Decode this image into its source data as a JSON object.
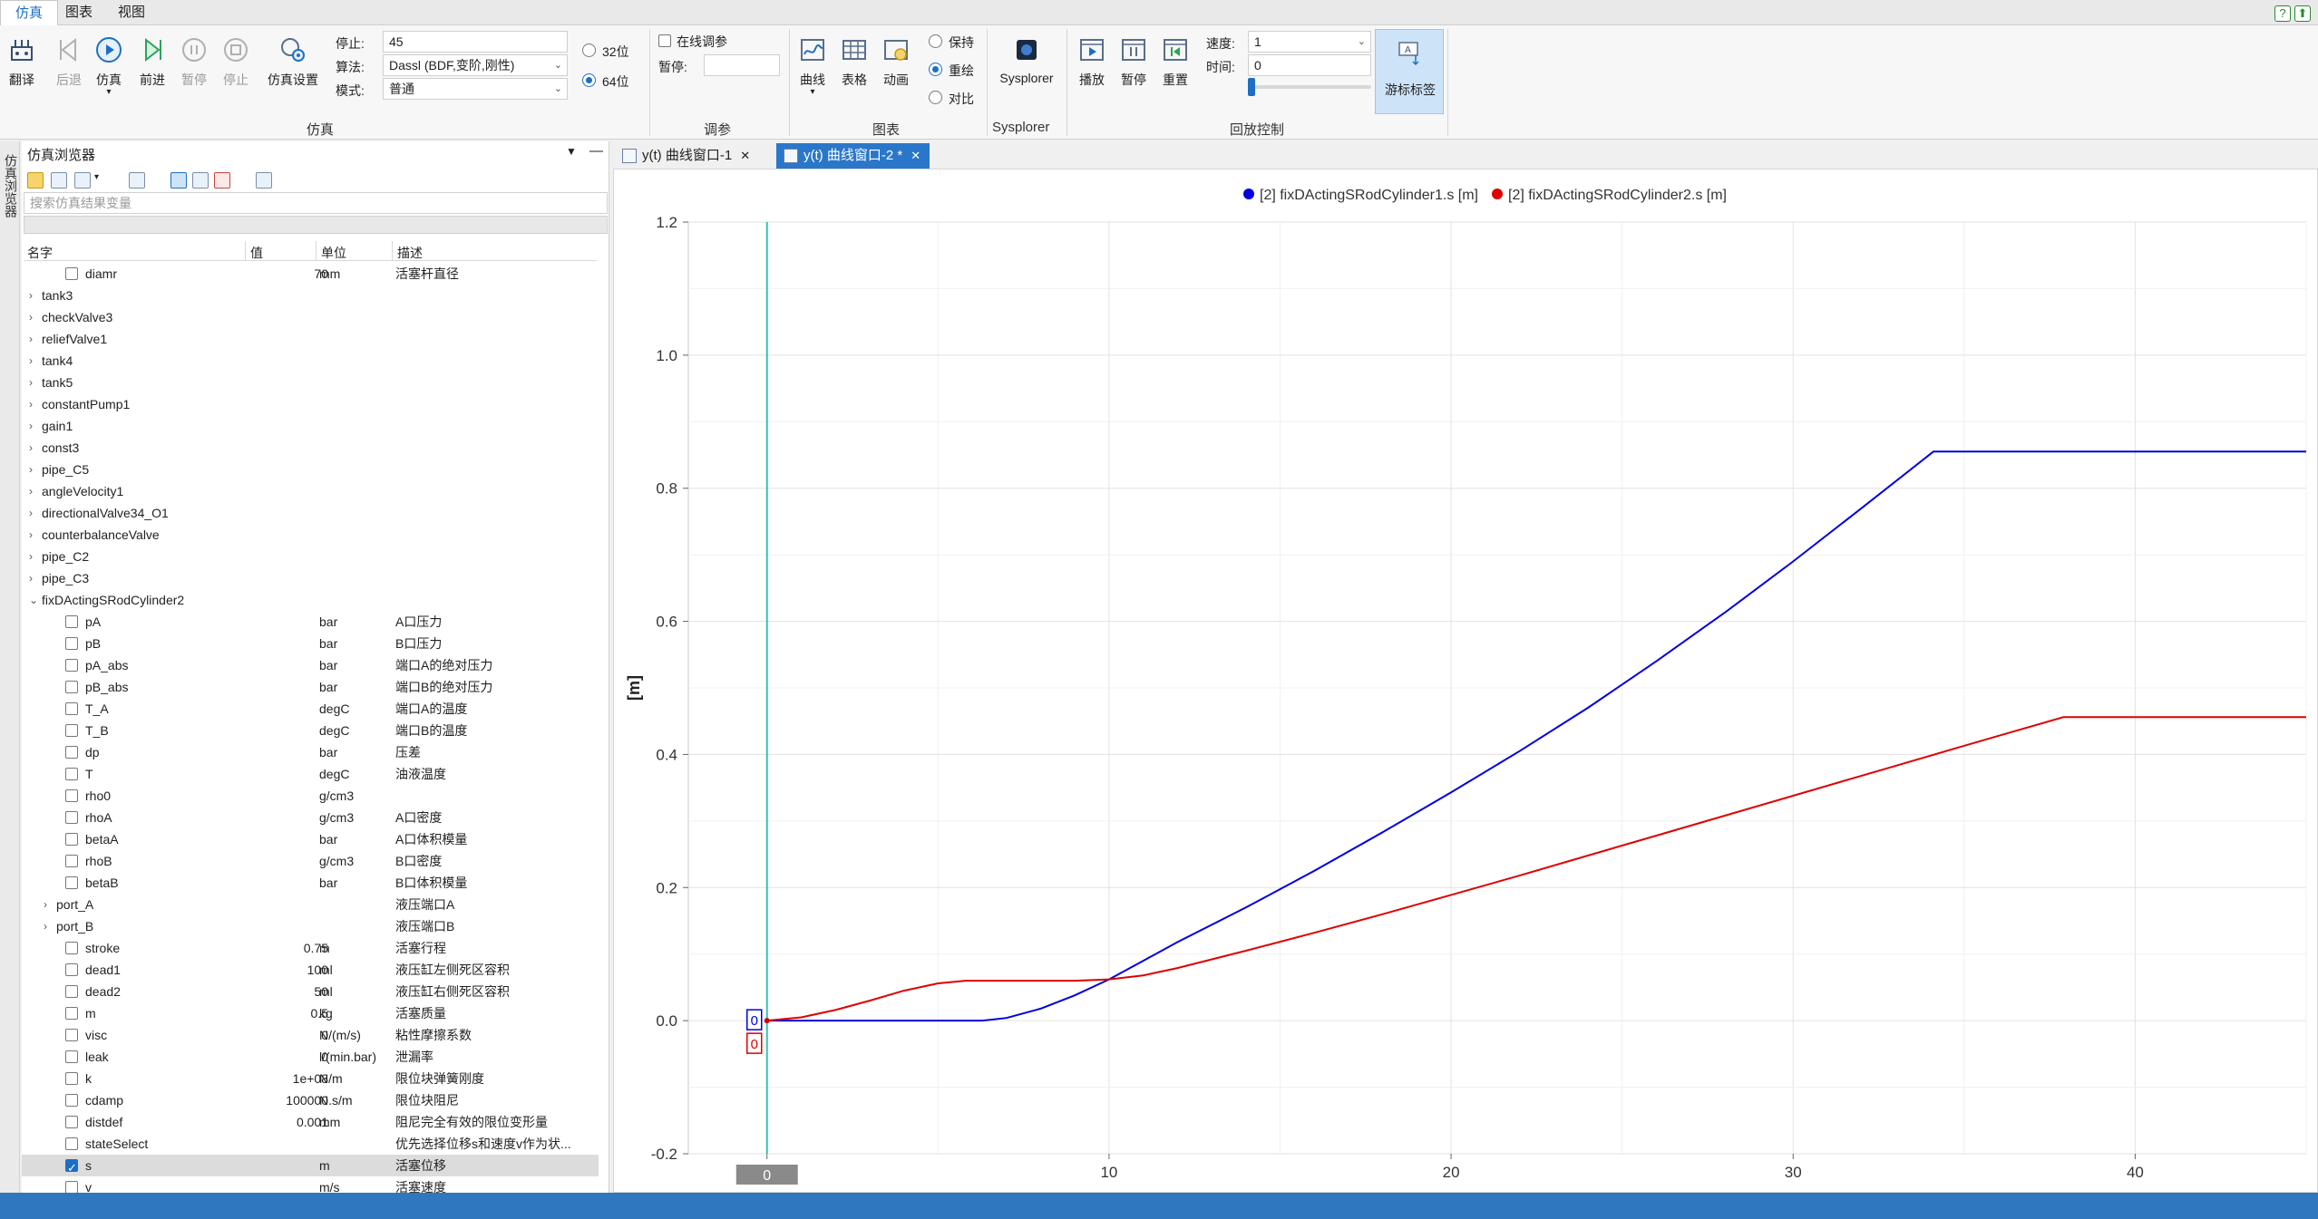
{
  "menu": {
    "tabs": [
      "仿真",
      "图表",
      "视图"
    ]
  },
  "ribbon": {
    "sim": {
      "translate": "翻译",
      "back": "后退",
      "simulate": "仿真",
      "forward": "前进",
      "pause": "暂停",
      "stop": "停止",
      "settings": "仿真设置",
      "group": "仿真"
    },
    "stop_label": "停止:",
    "stop_value": "45",
    "algo_label": "算法:",
    "algo_value": "Dassl (BDF,变阶,刚性)",
    "mode_label": "模式:",
    "mode_value": "普通",
    "bit32": "32位",
    "bit64": "64位",
    "tune": {
      "online": "在线调参",
      "pause_label": "暂停:",
      "pause_value": "",
      "group": "调参"
    },
    "chart": {
      "curve": "曲线",
      "table": "表格",
      "anim": "动画",
      "group": "图表",
      "keep": "保持",
      "redraw": "重绘",
      "compare": "对比"
    },
    "sysplorer": {
      "label": "Sysplorer",
      "group": "Sysplorer"
    },
    "playback": {
      "play": "播放",
      "pause": "暂停",
      "reset": "重置",
      "speed_label": "速度:",
      "speed_value": "1",
      "time_label": "时间:",
      "time_value": "0",
      "cursor": "游标标签",
      "group": "回放控制"
    }
  },
  "side_tab": "仿真浏览器",
  "browser": {
    "title": "仿真浏览器",
    "search_placeholder": "搜索仿真结果变量",
    "headers": {
      "name": "名字",
      "value": "值",
      "unit": "单位",
      "desc": "描述"
    },
    "rows": [
      {
        "level": 2,
        "type": "var",
        "name": "diamr",
        "value": "70",
        "unit": "mm",
        "desc": "活塞杆直径",
        "checked": false
      },
      {
        "level": 1,
        "type": "node",
        "name": "tank3",
        "expanded": false
      },
      {
        "level": 1,
        "type": "node",
        "name": "checkValve3",
        "expanded": false
      },
      {
        "level": 1,
        "type": "node",
        "name": "reliefValve1",
        "expanded": false
      },
      {
        "level": 1,
        "type": "node",
        "name": "tank4",
        "expanded": false
      },
      {
        "level": 1,
        "type": "node",
        "name": "tank5",
        "expanded": false
      },
      {
        "level": 1,
        "type": "node",
        "name": "constantPump1",
        "expanded": false
      },
      {
        "level": 1,
        "type": "node",
        "name": "gain1",
        "expanded": false
      },
      {
        "level": 1,
        "type": "node",
        "name": "const3",
        "expanded": false
      },
      {
        "level": 1,
        "type": "node",
        "name": "pipe_C5",
        "expanded": false
      },
      {
        "level": 1,
        "type": "node",
        "name": "angleVelocity1",
        "expanded": false
      },
      {
        "level": 1,
        "type": "node",
        "name": "directionalValve34_O1",
        "expanded": false
      },
      {
        "level": 1,
        "type": "node",
        "name": "counterbalanceValve",
        "expanded": false
      },
      {
        "level": 1,
        "type": "node",
        "name": "pipe_C2",
        "expanded": false
      },
      {
        "level": 1,
        "type": "node",
        "name": "pipe_C3",
        "expanded": false
      },
      {
        "level": 1,
        "type": "node",
        "name": "fixDActingSRodCylinder2",
        "expanded": true
      },
      {
        "level": 2,
        "type": "var",
        "name": "pA",
        "value": "",
        "unit": "bar",
        "desc": "A口压力",
        "checked": false
      },
      {
        "level": 2,
        "type": "var",
        "name": "pB",
        "value": "",
        "unit": "bar",
        "desc": "B口压力",
        "checked": false
      },
      {
        "level": 2,
        "type": "var",
        "name": "pA_abs",
        "value": "",
        "unit": "bar",
        "desc": "端口A的绝对压力",
        "checked": false
      },
      {
        "level": 2,
        "type": "var",
        "name": "pB_abs",
        "value": "",
        "unit": "bar",
        "desc": "端口B的绝对压力",
        "checked": false
      },
      {
        "level": 2,
        "type": "var",
        "name": "T_A",
        "value": "",
        "unit": "degC",
        "desc": "端口A的温度",
        "checked": false
      },
      {
        "level": 2,
        "type": "var",
        "name": "T_B",
        "value": "",
        "unit": "degC",
        "desc": "端口B的温度",
        "checked": false
      },
      {
        "level": 2,
        "type": "var",
        "name": "dp",
        "value": "",
        "unit": "bar",
        "desc": "压差",
        "checked": false
      },
      {
        "level": 2,
        "type": "var",
        "name": "T",
        "value": "",
        "unit": "degC",
        "desc": "油液温度",
        "checked": false
      },
      {
        "level": 2,
        "type": "var",
        "name": "rho0",
        "value": "",
        "unit": "g/cm3",
        "desc": "",
        "checked": false
      },
      {
        "level": 2,
        "type": "var",
        "name": "rhoA",
        "value": "",
        "unit": "g/cm3",
        "desc": "A口密度",
        "checked": false
      },
      {
        "level": 2,
        "type": "var",
        "name": "betaA",
        "value": "",
        "unit": "bar",
        "desc": "A口体积模量",
        "checked": false
      },
      {
        "level": 2,
        "type": "var",
        "name": "rhoB",
        "value": "",
        "unit": "g/cm3",
        "desc": "B口密度",
        "checked": false
      },
      {
        "level": 2,
        "type": "var",
        "name": "betaB",
        "value": "",
        "unit": "bar",
        "desc": "B口体积模量",
        "checked": false
      },
      {
        "level": 2,
        "type": "node",
        "name": "port_A",
        "desc": "液压端口A",
        "expanded": false
      },
      {
        "level": 2,
        "type": "node",
        "name": "port_B",
        "desc": "液压端口B",
        "expanded": false
      },
      {
        "level": 2,
        "type": "var",
        "name": "stroke",
        "value": "0.75",
        "unit": "m",
        "desc": "活塞行程",
        "checked": false
      },
      {
        "level": 2,
        "type": "var",
        "name": "dead1",
        "value": "100",
        "unit": "ml",
        "desc": "液压缸左侧死区容积",
        "checked": false
      },
      {
        "level": 2,
        "type": "var",
        "name": "dead2",
        "value": "50",
        "unit": "ml",
        "desc": "液压缸右侧死区容积",
        "checked": false
      },
      {
        "level": 2,
        "type": "var",
        "name": "m",
        "value": "0.5",
        "unit": "kg",
        "desc": "活塞质量",
        "checked": false
      },
      {
        "level": 2,
        "type": "var",
        "name": "visc",
        "value": "0",
        "unit": "N/(m/s)",
        "desc": "粘性摩擦系数",
        "checked": false
      },
      {
        "level": 2,
        "type": "var",
        "name": "leak",
        "value": "0",
        "unit": "l/(min.bar)",
        "desc": "泄漏率",
        "checked": false
      },
      {
        "level": 2,
        "type": "var",
        "name": "k",
        "value": "1e+08",
        "unit": "N/m",
        "desc": "限位块弹簧刚度",
        "checked": false
      },
      {
        "level": 2,
        "type": "var",
        "name": "cdamp",
        "value": "100000",
        "unit": "N.s/m",
        "desc": "限位块阻尼",
        "checked": false
      },
      {
        "level": 2,
        "type": "var",
        "name": "distdef",
        "value": "0.001",
        "unit": "mm",
        "desc": "阻尼完全有效的限位变形量",
        "checked": false
      },
      {
        "level": 2,
        "type": "var",
        "name": "stateSelect",
        "value": "",
        "unit": "",
        "desc": "优先选择位移s和速度v作为状...",
        "checked": false
      },
      {
        "level": 2,
        "type": "var",
        "name": "s",
        "value": "",
        "unit": "m",
        "desc": "活塞位移",
        "checked": true,
        "selected": true
      },
      {
        "level": 2,
        "type": "var",
        "name": "v",
        "value": "",
        "unit": "m/s",
        "desc": "活塞速度",
        "checked": false
      }
    ]
  },
  "plot_tabs": [
    {
      "label": "y(t) 曲线窗口-1",
      "active": false
    },
    {
      "label": "y(t) 曲线窗口-2 *",
      "active": true
    }
  ],
  "cursor": {
    "x_label": "0",
    "y_labels": [
      "0",
      "0"
    ]
  },
  "chart_data": {
    "type": "line",
    "xlim": [
      -2.3,
      45
    ],
    "ylim": [
      -0.2,
      1.2
    ],
    "xticks": [
      0,
      10,
      20,
      30,
      40
    ],
    "yticks": [
      -0.2,
      0.0,
      0.2,
      0.4,
      0.6,
      0.8,
      1.0,
      1.2
    ],
    "ylabel": "[m]",
    "grid": true,
    "legend_position": "top-center",
    "series": [
      {
        "name": "[2] fixDActingSRodCylinder1.s [m]",
        "color": "#0000e0",
        "x": [
          0,
          4,
          6.3,
          7,
          8,
          9,
          10,
          11,
          12,
          14,
          16,
          18,
          20,
          22,
          24,
          26,
          28,
          30,
          32,
          34.1,
          36,
          40,
          45
        ],
        "y": [
          0,
          0,
          0,
          0.004,
          0.018,
          0.038,
          0.062,
          0.09,
          0.118,
          0.17,
          0.225,
          0.283,
          0.343,
          0.405,
          0.47,
          0.54,
          0.613,
          0.69,
          0.77,
          0.855,
          0.855,
          0.855,
          0.855
        ]
      },
      {
        "name": "[2] fixDActingSRodCylinder2.s [m]",
        "color": "#e00000",
        "x": [
          0,
          1,
          2,
          3,
          4,
          5,
          5.8,
          7,
          9,
          10,
          11,
          12,
          14,
          16,
          18,
          20,
          22,
          24,
          26,
          28,
          30,
          32,
          34,
          36,
          37.9,
          40,
          45
        ],
        "y": [
          0,
          0.005,
          0.016,
          0.03,
          0.045,
          0.056,
          0.06,
          0.06,
          0.06,
          0.062,
          0.068,
          0.079,
          0.105,
          0.132,
          0.16,
          0.189,
          0.218,
          0.248,
          0.278,
          0.308,
          0.338,
          0.368,
          0.398,
          0.428,
          0.456,
          0.456,
          0.456
        ]
      }
    ]
  }
}
